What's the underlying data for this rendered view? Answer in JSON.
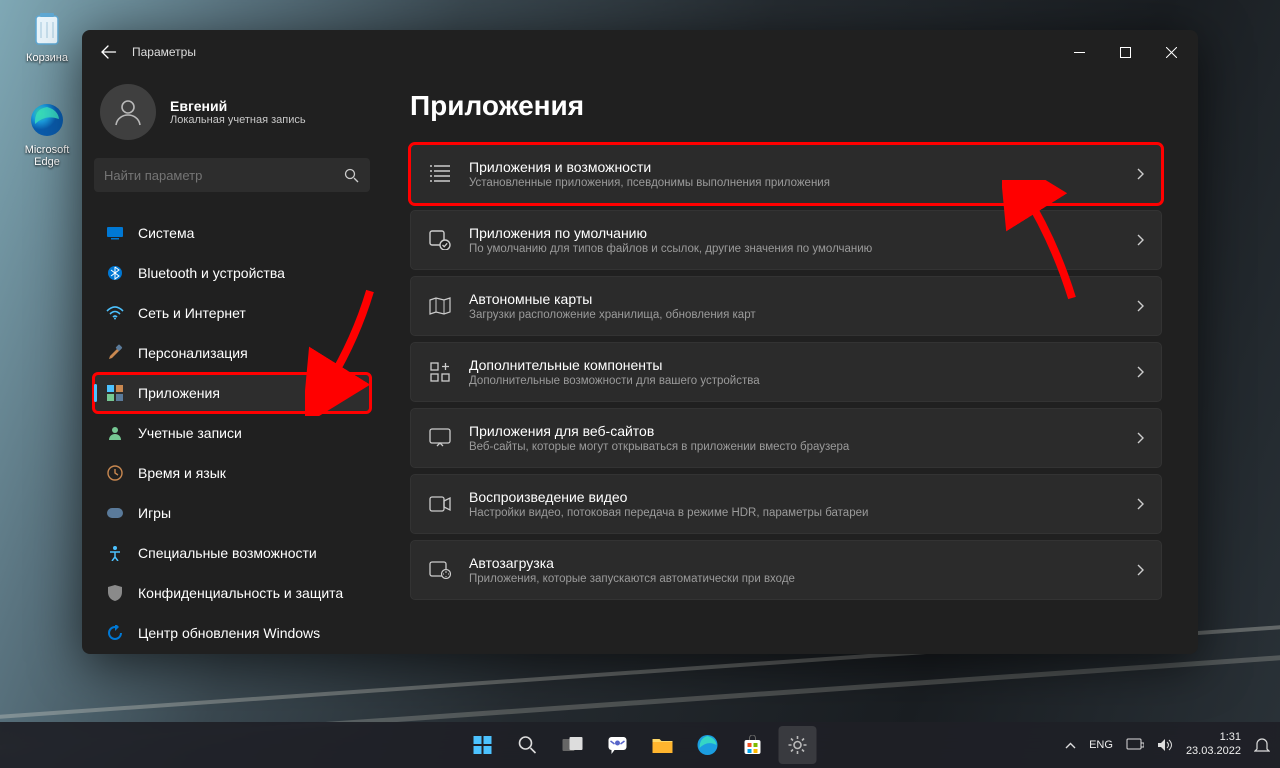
{
  "desktop": {
    "recycle": "Корзина",
    "edge": "Microsoft Edge"
  },
  "window": {
    "title": "Параметры",
    "user": {
      "name": "Евгений",
      "sub": "Локальная учетная запись"
    },
    "search_placeholder": "Найти параметр",
    "nav": [
      {
        "label": "Система"
      },
      {
        "label": "Bluetooth и устройства"
      },
      {
        "label": "Сеть и Интернет"
      },
      {
        "label": "Персонализация"
      },
      {
        "label": "Приложения"
      },
      {
        "label": "Учетные записи"
      },
      {
        "label": "Время и язык"
      },
      {
        "label": "Игры"
      },
      {
        "label": "Специальные возможности"
      },
      {
        "label": "Конфиденциальность и защита"
      },
      {
        "label": "Центр обновления Windows"
      }
    ],
    "page_title": "Приложения",
    "cards": [
      {
        "title": "Приложения и возможности",
        "sub": "Установленные приложения, псевдонимы выполнения приложения"
      },
      {
        "title": "Приложения по умолчанию",
        "sub": "По умолчанию для типов файлов и ссылок, другие значения по умолчанию"
      },
      {
        "title": "Автономные карты",
        "sub": "Загрузки расположение хранилища, обновления карт"
      },
      {
        "title": "Дополнительные компоненты",
        "sub": "Дополнительные возможности для вашего устройства"
      },
      {
        "title": "Приложения для веб-сайтов",
        "sub": "Веб-сайты, которые могут открываться в приложении вместо браузера"
      },
      {
        "title": "Воспроизведение видео",
        "sub": "Настройки видео, потоковая передача в режиме HDR, параметры батареи"
      },
      {
        "title": "Автозагрузка",
        "sub": "Приложения, которые запускаются автоматически при входе"
      }
    ]
  },
  "tray": {
    "lang": "ENG",
    "time": "1:31",
    "date": "23.03.2022"
  }
}
